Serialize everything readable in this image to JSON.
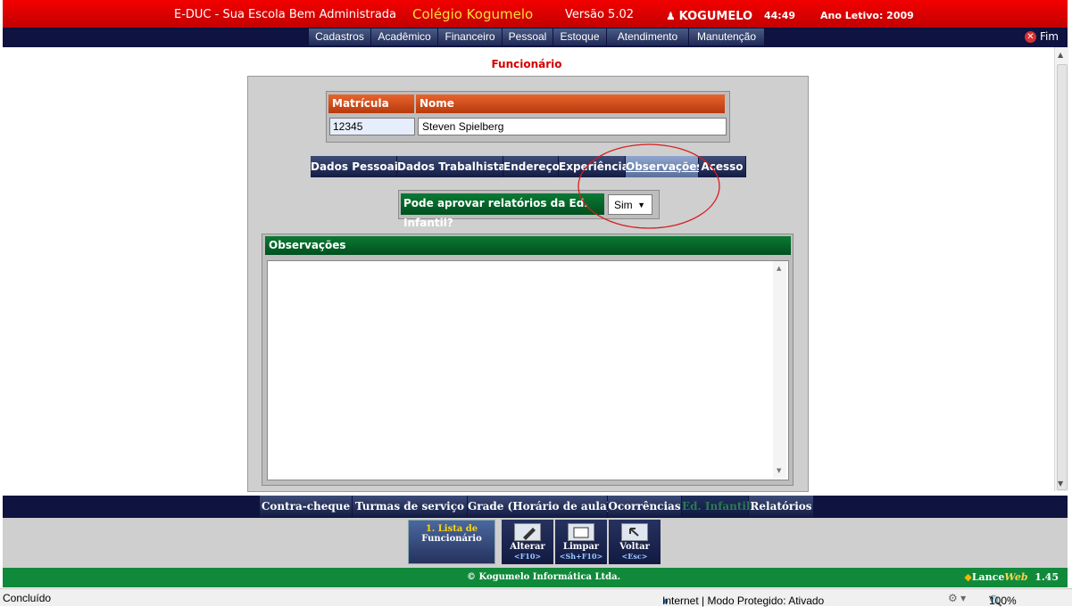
{
  "header": {
    "app_name": "E-DUC - Sua Escola Bem Administrada",
    "school": "Colégio Kogumelo",
    "version": "Versão 5.02",
    "user": "KOGUMELO",
    "time": "44:49",
    "year": "Ano Letivo: 2009"
  },
  "nav": {
    "items": [
      "Cadastros",
      "Acadêmico",
      "Financeiro",
      "Pessoal",
      "Estoque",
      "Atendimento",
      "Manutenção"
    ],
    "exit": "Fim"
  },
  "page": {
    "title": "Funcionário"
  },
  "form": {
    "matricula_label": "Matrícula",
    "matricula_value": "12345",
    "nome_label": "Nome",
    "nome_value": "Steven Spielberg"
  },
  "tabs": [
    "Dados Pessoais",
    "Dados Trabalhistas",
    "Endereço",
    "Experiência",
    "Observações",
    "Acesso"
  ],
  "approval": {
    "question": "Pode aprovar relatórios da Ed. Infantil?",
    "value": "Sim"
  },
  "observations": {
    "label": "Observações",
    "text": ""
  },
  "bottom_nav": [
    "Contra-cheque",
    "Turmas de serviço",
    "Grade (Horário de aula)",
    "Ocorrências",
    "Ed. Infantil",
    "Relatórios"
  ],
  "toolbar": {
    "list_line1": "1. Lista de",
    "list_line2": "Funcionário",
    "alter": "Alterar",
    "alter_key": "<F10>",
    "clear": "Limpar",
    "clear_key": "<Sh+F10>",
    "back": "Voltar",
    "back_key": "<Esc>"
  },
  "footer": {
    "copyright": "© Kogumelo Informática Ltda.",
    "brand_a": "Lance",
    "brand_b": "Web",
    "brand_version": "1.45"
  },
  "status": {
    "left": "Concluído",
    "zone": "Internet | Modo Protegido: Ativado",
    "zoom": "100%"
  },
  "colors": {
    "top_red": "#d40000",
    "nav_navy": "#0e1340",
    "green": "#108a3a",
    "orange_header": "#d2521c"
  }
}
